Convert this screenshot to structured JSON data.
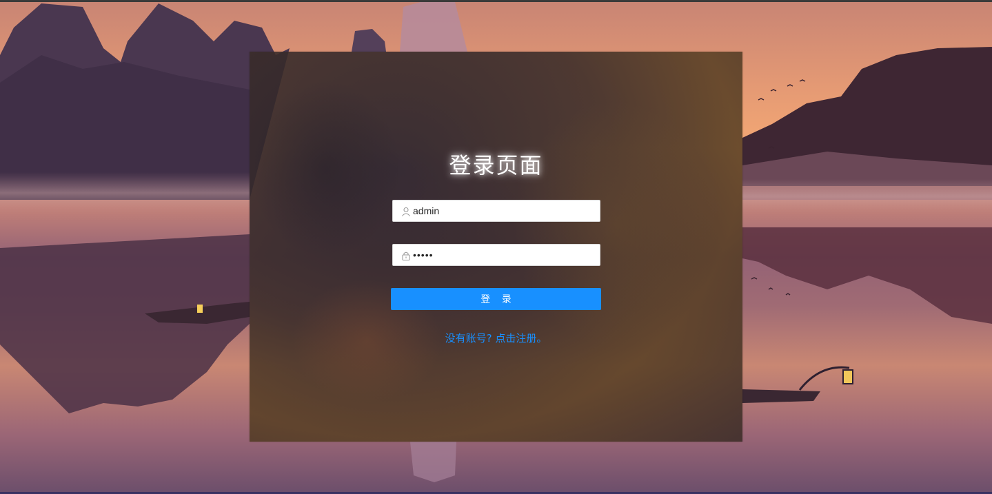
{
  "login": {
    "title": "登录页面",
    "username": {
      "value": "admin",
      "icon": "user-icon"
    },
    "password": {
      "value": "admin",
      "icon": "lock-icon"
    },
    "submit_label": "登 录",
    "register_link": "没有账号? 点击注册。"
  },
  "colors": {
    "primary": "#1890ff",
    "panel": "#3b2f2c",
    "title": "#ffffff"
  }
}
